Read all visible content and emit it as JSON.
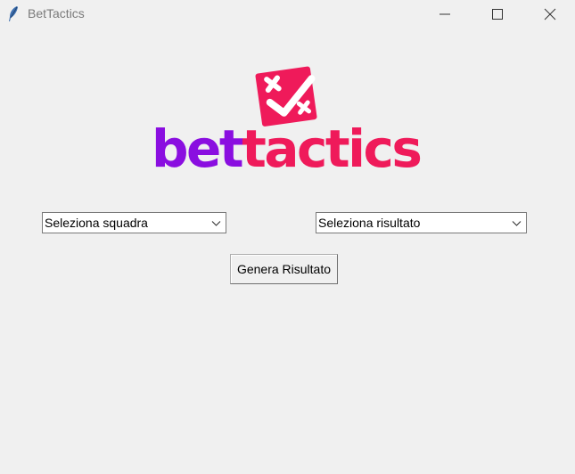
{
  "window": {
    "title": "BetTactics",
    "icons": {
      "app": "feather-icon",
      "minimize": "minimize-icon",
      "maximize": "maximize-icon",
      "close": "close-icon"
    }
  },
  "logo": {
    "word_part1": "bet",
    "word_part2": "tactics",
    "colors": {
      "purple": "#8a0ee0",
      "pink": "#ef1a5a"
    },
    "mark_icon": "ticket-check-icon"
  },
  "form": {
    "team_select": {
      "value": "Seleziona squadra",
      "icon": "chevron-down-icon"
    },
    "result_select": {
      "value": "Seleziona risultato",
      "icon": "chevron-down-icon"
    },
    "generate_button": "Genera Risultato"
  }
}
